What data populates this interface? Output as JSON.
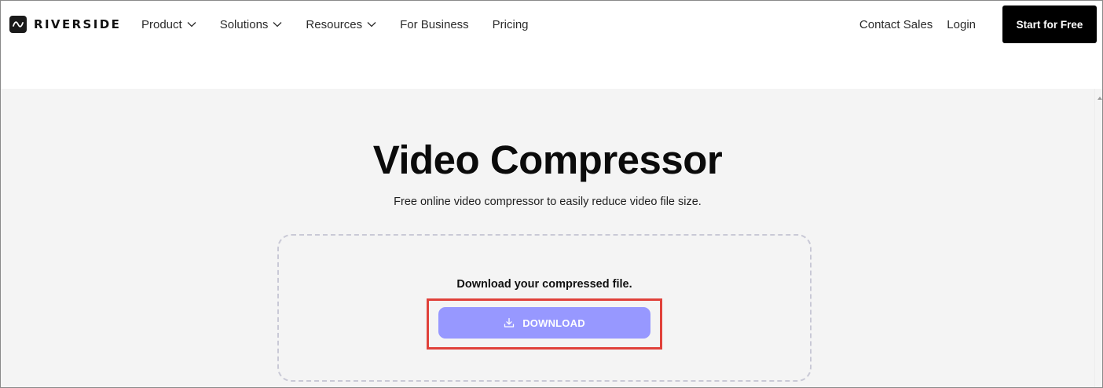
{
  "header": {
    "logo_text": "RIVERSIDE",
    "logo_icon": "waveform-icon",
    "nav": [
      {
        "label": "Product",
        "has_dropdown": true
      },
      {
        "label": "Solutions",
        "has_dropdown": true
      },
      {
        "label": "Resources",
        "has_dropdown": true
      },
      {
        "label": "For Business",
        "has_dropdown": false
      },
      {
        "label": "Pricing",
        "has_dropdown": false
      }
    ],
    "contact_sales": "Contact Sales",
    "login": "Login",
    "cta": "Start for Free"
  },
  "main": {
    "title": "Video Compressor",
    "subtitle": "Free online video compressor to easily reduce video file size.",
    "dropzone": {
      "message": "Download your compressed file.",
      "button_label": "DOWNLOAD",
      "button_icon": "download-icon"
    }
  },
  "colors": {
    "cta_bg": "#000000",
    "download_button_bg": "#9798ff",
    "highlight_border": "#e0413a",
    "main_bg": "#f4f4f4"
  }
}
